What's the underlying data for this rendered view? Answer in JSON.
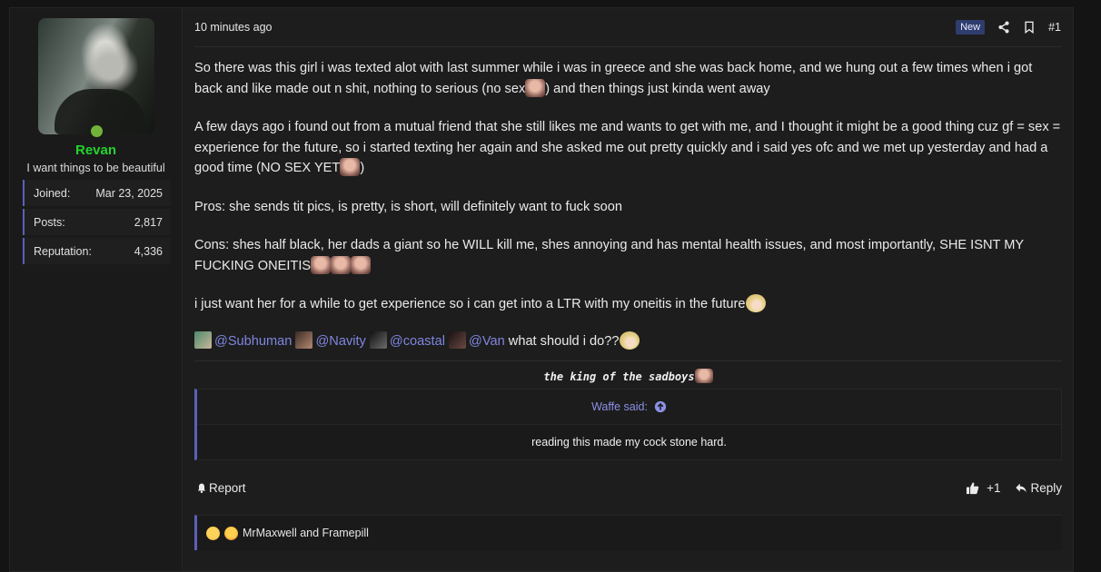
{
  "user": {
    "name": "Revan",
    "title": "I want things to be beautiful",
    "stats": [
      {
        "label": "Joined:",
        "value": "Mar 23, 2025"
      },
      {
        "label": "Posts:",
        "value": "2,817"
      },
      {
        "label": "Reputation:",
        "value": "4,336"
      }
    ]
  },
  "post": {
    "time": "10 minutes ago",
    "badge": "New",
    "number": "#1",
    "p1a": "So there was this girl i was texted alot with last summer while i was in greece and she was back home, and we hung out a few times when i got back and like made out n shit, nothing to serious (no sex",
    "p1b": ") and then things just kinda went away",
    "p2a": "A few days ago i found out from a mutual friend that she still likes me and wants to get with me, and I thought it might be a good thing cuz gf = sex = experience for the future, so i started texting her again and she asked me out pretty quickly and i said yes ofc and we met up yesterday and had a good time (NO SEX YET",
    "p2b": ")",
    "p3": "Pros: she sends tit pics, is pretty, is short, will definitely want to fuck soon",
    "p4": "Cons: shes half black, her dads a giant so he WILL kill me, shes annoying and has mental health issues, and most importantly, SHE ISNT MY FUCKING ONEITIS",
    "p5": "i just want her for a while to get experience so i can get into a LTR with my oneitis in the future",
    "mentions": [
      "@Subhuman",
      "@Navity",
      "@coastal",
      "@Van"
    ],
    "mentions_tail": " what should i do??",
    "signature": "the king of the sadboys",
    "quote": {
      "author": "Waffe said:",
      "text": "reading this made my cock stone hard."
    },
    "actions": {
      "report": "Report",
      "likes": "+1",
      "reply": "Reply"
    },
    "reactions_text": "MrMaxwell and Framepill"
  },
  "colors": {
    "accent": "#5c5fb8",
    "username": "#23d32e",
    "mention": "#7f86e0",
    "online": "#71b33a"
  },
  "icons": [
    "share-icon",
    "bookmark-icon",
    "bell-icon",
    "thumbs-up-icon",
    "reply-icon",
    "arrow-up-circle-icon"
  ]
}
